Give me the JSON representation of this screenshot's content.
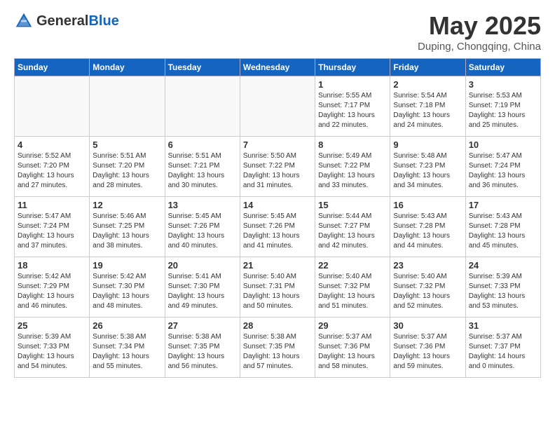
{
  "header": {
    "logo_general": "General",
    "logo_blue": "Blue",
    "title": "May 2025",
    "location": "Duping, Chongqing, China"
  },
  "weekdays": [
    "Sunday",
    "Monday",
    "Tuesday",
    "Wednesday",
    "Thursday",
    "Friday",
    "Saturday"
  ],
  "weeks": [
    [
      {
        "day": "",
        "info": ""
      },
      {
        "day": "",
        "info": ""
      },
      {
        "day": "",
        "info": ""
      },
      {
        "day": "",
        "info": ""
      },
      {
        "day": "1",
        "info": "Sunrise: 5:55 AM\nSunset: 7:17 PM\nDaylight: 13 hours\nand 22 minutes."
      },
      {
        "day": "2",
        "info": "Sunrise: 5:54 AM\nSunset: 7:18 PM\nDaylight: 13 hours\nand 24 minutes."
      },
      {
        "day": "3",
        "info": "Sunrise: 5:53 AM\nSunset: 7:19 PM\nDaylight: 13 hours\nand 25 minutes."
      }
    ],
    [
      {
        "day": "4",
        "info": "Sunrise: 5:52 AM\nSunset: 7:20 PM\nDaylight: 13 hours\nand 27 minutes."
      },
      {
        "day": "5",
        "info": "Sunrise: 5:51 AM\nSunset: 7:20 PM\nDaylight: 13 hours\nand 28 minutes."
      },
      {
        "day": "6",
        "info": "Sunrise: 5:51 AM\nSunset: 7:21 PM\nDaylight: 13 hours\nand 30 minutes."
      },
      {
        "day": "7",
        "info": "Sunrise: 5:50 AM\nSunset: 7:22 PM\nDaylight: 13 hours\nand 31 minutes."
      },
      {
        "day": "8",
        "info": "Sunrise: 5:49 AM\nSunset: 7:22 PM\nDaylight: 13 hours\nand 33 minutes."
      },
      {
        "day": "9",
        "info": "Sunrise: 5:48 AM\nSunset: 7:23 PM\nDaylight: 13 hours\nand 34 minutes."
      },
      {
        "day": "10",
        "info": "Sunrise: 5:47 AM\nSunset: 7:24 PM\nDaylight: 13 hours\nand 36 minutes."
      }
    ],
    [
      {
        "day": "11",
        "info": "Sunrise: 5:47 AM\nSunset: 7:24 PM\nDaylight: 13 hours\nand 37 minutes."
      },
      {
        "day": "12",
        "info": "Sunrise: 5:46 AM\nSunset: 7:25 PM\nDaylight: 13 hours\nand 38 minutes."
      },
      {
        "day": "13",
        "info": "Sunrise: 5:45 AM\nSunset: 7:26 PM\nDaylight: 13 hours\nand 40 minutes."
      },
      {
        "day": "14",
        "info": "Sunrise: 5:45 AM\nSunset: 7:26 PM\nDaylight: 13 hours\nand 41 minutes."
      },
      {
        "day": "15",
        "info": "Sunrise: 5:44 AM\nSunset: 7:27 PM\nDaylight: 13 hours\nand 42 minutes."
      },
      {
        "day": "16",
        "info": "Sunrise: 5:43 AM\nSunset: 7:28 PM\nDaylight: 13 hours\nand 44 minutes."
      },
      {
        "day": "17",
        "info": "Sunrise: 5:43 AM\nSunset: 7:28 PM\nDaylight: 13 hours\nand 45 minutes."
      }
    ],
    [
      {
        "day": "18",
        "info": "Sunrise: 5:42 AM\nSunset: 7:29 PM\nDaylight: 13 hours\nand 46 minutes."
      },
      {
        "day": "19",
        "info": "Sunrise: 5:42 AM\nSunset: 7:30 PM\nDaylight: 13 hours\nand 48 minutes."
      },
      {
        "day": "20",
        "info": "Sunrise: 5:41 AM\nSunset: 7:30 PM\nDaylight: 13 hours\nand 49 minutes."
      },
      {
        "day": "21",
        "info": "Sunrise: 5:40 AM\nSunset: 7:31 PM\nDaylight: 13 hours\nand 50 minutes."
      },
      {
        "day": "22",
        "info": "Sunrise: 5:40 AM\nSunset: 7:32 PM\nDaylight: 13 hours\nand 51 minutes."
      },
      {
        "day": "23",
        "info": "Sunrise: 5:40 AM\nSunset: 7:32 PM\nDaylight: 13 hours\nand 52 minutes."
      },
      {
        "day": "24",
        "info": "Sunrise: 5:39 AM\nSunset: 7:33 PM\nDaylight: 13 hours\nand 53 minutes."
      }
    ],
    [
      {
        "day": "25",
        "info": "Sunrise: 5:39 AM\nSunset: 7:33 PM\nDaylight: 13 hours\nand 54 minutes."
      },
      {
        "day": "26",
        "info": "Sunrise: 5:38 AM\nSunset: 7:34 PM\nDaylight: 13 hours\nand 55 minutes."
      },
      {
        "day": "27",
        "info": "Sunrise: 5:38 AM\nSunset: 7:35 PM\nDaylight: 13 hours\nand 56 minutes."
      },
      {
        "day": "28",
        "info": "Sunrise: 5:38 AM\nSunset: 7:35 PM\nDaylight: 13 hours\nand 57 minutes."
      },
      {
        "day": "29",
        "info": "Sunrise: 5:37 AM\nSunset: 7:36 PM\nDaylight: 13 hours\nand 58 minutes."
      },
      {
        "day": "30",
        "info": "Sunrise: 5:37 AM\nSunset: 7:36 PM\nDaylight: 13 hours\nand 59 minutes."
      },
      {
        "day": "31",
        "info": "Sunrise: 5:37 AM\nSunset: 7:37 PM\nDaylight: 14 hours\nand 0 minutes."
      }
    ]
  ]
}
